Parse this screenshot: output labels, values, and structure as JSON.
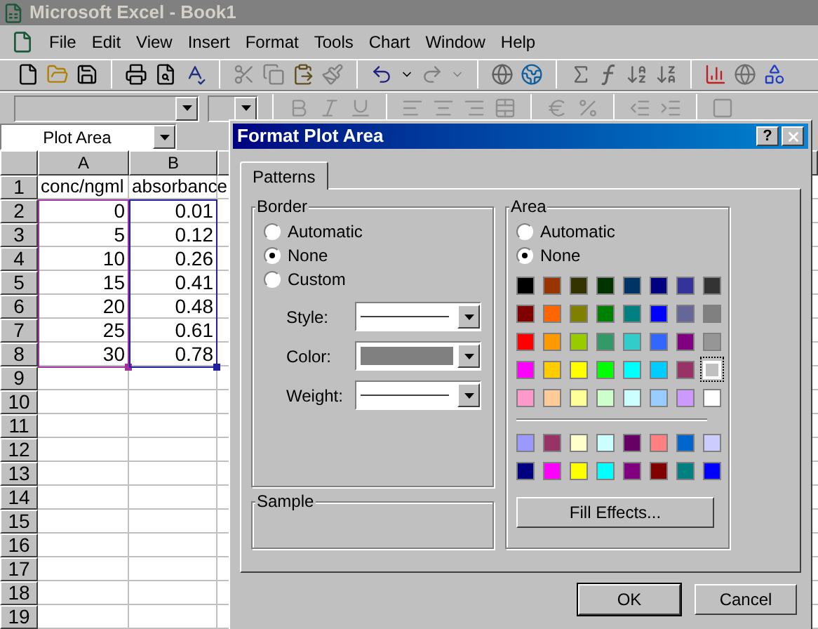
{
  "window": {
    "title": "Microsoft Excel - Book1"
  },
  "menu": [
    "File",
    "Edit",
    "View",
    "Insert",
    "Format",
    "Tools",
    "Chart",
    "Window",
    "Help"
  ],
  "name_box": {
    "value": "Plot Area"
  },
  "sheet": {
    "columns": [
      {
        "label": "A"
      },
      {
        "label": "B"
      }
    ],
    "rows": [
      {
        "header": "1",
        "cells": [
          {
            "kind": "text",
            "value": "conc/ngml"
          },
          {
            "kind": "text",
            "value": "absorbance"
          }
        ]
      },
      {
        "header": "2",
        "cells": [
          {
            "kind": "number",
            "value": "0"
          },
          {
            "kind": "number",
            "value": "0.01"
          }
        ]
      },
      {
        "header": "3",
        "cells": [
          {
            "kind": "number",
            "value": "5"
          },
          {
            "kind": "number",
            "value": "0.12"
          }
        ]
      },
      {
        "header": "4",
        "cells": [
          {
            "kind": "number",
            "value": "10"
          },
          {
            "kind": "number",
            "value": "0.26"
          }
        ]
      },
      {
        "header": "5",
        "cells": [
          {
            "kind": "number",
            "value": "15"
          },
          {
            "kind": "number",
            "value": "0.41"
          }
        ]
      },
      {
        "header": "6",
        "cells": [
          {
            "kind": "number",
            "value": "20"
          },
          {
            "kind": "number",
            "value": "0.48"
          }
        ]
      },
      {
        "header": "7",
        "cells": [
          {
            "kind": "number",
            "value": "25"
          },
          {
            "kind": "number",
            "value": "0.61"
          }
        ]
      },
      {
        "header": "8",
        "cells": [
          {
            "kind": "number",
            "value": "30"
          },
          {
            "kind": "number",
            "value": "0.78"
          }
        ]
      },
      {
        "header": "9",
        "cells": []
      },
      {
        "header": "10",
        "cells": []
      },
      {
        "header": "11",
        "cells": []
      },
      {
        "header": "12",
        "cells": []
      },
      {
        "header": "13",
        "cells": []
      },
      {
        "header": "14",
        "cells": []
      },
      {
        "header": "15",
        "cells": []
      },
      {
        "header": "16",
        "cells": []
      },
      {
        "header": "17",
        "cells": []
      },
      {
        "header": "18",
        "cells": []
      },
      {
        "header": "19",
        "cells": []
      }
    ]
  },
  "dialog": {
    "title": "Format Plot Area",
    "help": "?",
    "tabs": [
      {
        "label": "Patterns",
        "selected": true
      }
    ],
    "border": {
      "title": "Border",
      "options": [
        {
          "label": "Automatic",
          "selected": false
        },
        {
          "label": "None",
          "selected": true
        },
        {
          "label": "Custom",
          "selected": false
        }
      ],
      "fields": [
        {
          "label": "Style:",
          "kind": "line"
        },
        {
          "label": "Color:",
          "kind": "color",
          "color": "#808080"
        },
        {
          "label": "Weight:",
          "kind": "line"
        }
      ]
    },
    "sample": {
      "title": "Sample"
    },
    "area": {
      "title": "Area",
      "options": [
        {
          "label": "Automatic",
          "selected": false
        },
        {
          "label": "None",
          "selected": true
        }
      ],
      "palette": [
        [
          {
            "color": "#000000",
            "selected": false
          },
          {
            "color": "#993300",
            "selected": false
          },
          {
            "color": "#333300",
            "selected": false
          },
          {
            "color": "#003300",
            "selected": false
          },
          {
            "color": "#003366",
            "selected": false
          },
          {
            "color": "#000080",
            "selected": false
          },
          {
            "color": "#333399",
            "selected": false
          },
          {
            "color": "#333333",
            "selected": false
          }
        ],
        [
          {
            "color": "#800000",
            "selected": false
          },
          {
            "color": "#ff6600",
            "selected": false
          },
          {
            "color": "#808000",
            "selected": false
          },
          {
            "color": "#008000",
            "selected": false
          },
          {
            "color": "#008080",
            "selected": false
          },
          {
            "color": "#0000ff",
            "selected": false
          },
          {
            "color": "#666699",
            "selected": false
          },
          {
            "color": "#808080",
            "selected": false
          }
        ],
        [
          {
            "color": "#ff0000",
            "selected": false
          },
          {
            "color": "#ff9900",
            "selected": false
          },
          {
            "color": "#99cc00",
            "selected": false
          },
          {
            "color": "#339966",
            "selected": false
          },
          {
            "color": "#33cccc",
            "selected": false
          },
          {
            "color": "#3366ff",
            "selected": false
          },
          {
            "color": "#800080",
            "selected": false
          },
          {
            "color": "#969696",
            "selected": false
          }
        ],
        [
          {
            "color": "#ff00ff",
            "selected": false
          },
          {
            "color": "#ffcc00",
            "selected": false
          },
          {
            "color": "#ffff00",
            "selected": false
          },
          {
            "color": "#00ff00",
            "selected": false
          },
          {
            "color": "#00ffff",
            "selected": false
          },
          {
            "color": "#00ccff",
            "selected": false
          },
          {
            "color": "#993366",
            "selected": false
          },
          {
            "color": "#c0c0c0",
            "selected": true
          }
        ],
        [
          {
            "color": "#ff99cc",
            "selected": false
          },
          {
            "color": "#ffcc99",
            "selected": false
          },
          {
            "color": "#ffff99",
            "selected": false
          },
          {
            "color": "#ccffcc",
            "selected": false
          },
          {
            "color": "#ccffff",
            "selected": false
          },
          {
            "color": "#99ccff",
            "selected": false
          },
          {
            "color": "#cc99ff",
            "selected": false
          },
          {
            "color": "#ffffff",
            "selected": false
          }
        ]
      ],
      "chart_palette": [
        [
          {
            "color": "#9999ff",
            "selected": false
          },
          {
            "color": "#993366",
            "selected": false
          },
          {
            "color": "#ffffcc",
            "selected": false
          },
          {
            "color": "#ccffff",
            "selected": false
          },
          {
            "color": "#660066",
            "selected": false
          },
          {
            "color": "#ff8080",
            "selected": false
          },
          {
            "color": "#0066cc",
            "selected": false
          },
          {
            "color": "#ccccff",
            "selected": false
          }
        ],
        [
          {
            "color": "#000080",
            "selected": false
          },
          {
            "color": "#ff00ff",
            "selected": false
          },
          {
            "color": "#ffff00",
            "selected": false
          },
          {
            "color": "#00ffff",
            "selected": false
          },
          {
            "color": "#800080",
            "selected": false
          },
          {
            "color": "#800000",
            "selected": false
          },
          {
            "color": "#008080",
            "selected": false
          },
          {
            "color": "#0000ff",
            "selected": false
          }
        ]
      ],
      "fill_button": "Fill Effects..."
    },
    "buttons": [
      "OK",
      "Cancel"
    ]
  }
}
